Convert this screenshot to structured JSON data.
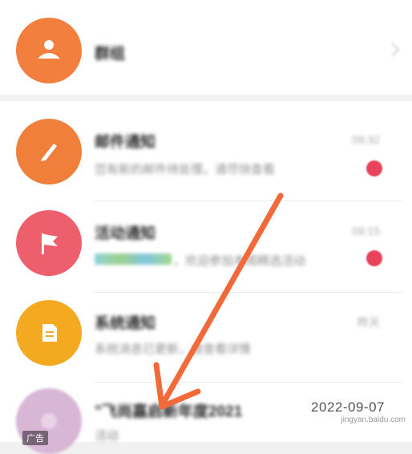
{
  "top_entry": {
    "title": "群组",
    "avatar_color": "#f27f3d",
    "icon": "group-icon"
  },
  "messages": [
    {
      "title": "邮件通知",
      "snippet": "您有新的邮件待处理，请尽快查看",
      "time": "09:32",
      "avatar_color": "#f07f3c",
      "icon": "pen-icon",
      "unread": true
    },
    {
      "title": "活动通知",
      "snippet": "，欢迎参加本周精选活动",
      "time": "09:15",
      "avatar_color": "#ee5f6d",
      "icon": "flag-icon",
      "unread": true
    },
    {
      "title": "系统通知",
      "snippet": "系统消息已更新，请查看详情",
      "time": "昨天",
      "avatar_color": "#f4aa20",
      "icon": "document-icon",
      "unread": false
    },
    {
      "title": "\"飞尚嘉启新年度2021",
      "snippet": "活动",
      "time": "2022-09-07",
      "avatar_color": "#d8b6d6",
      "icon": "photo-icon",
      "unread": false
    }
  ],
  "ad_label": "广告",
  "watermark": "jingyan.baidu.com",
  "annotation_arrow_color": "#f26a3a"
}
